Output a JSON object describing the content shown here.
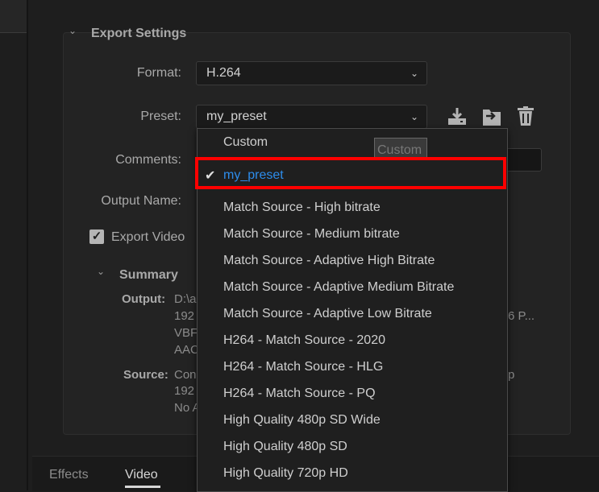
{
  "export_settings": {
    "title": "Export Settings",
    "format_label": "Format:",
    "format_value": "H.264",
    "preset_label": "Preset:",
    "preset_value": "my_preset",
    "comments_label": "Comments:",
    "output_name_label": "Output Name:",
    "export_video_label": "Export Video",
    "export_video_checked": true
  },
  "summary": {
    "title": "Summary",
    "output_label": "Output:",
    "output_lines": [
      "D:\\a",
      "192",
      "VBF",
      "AAC"
    ],
    "output_trailing": "6 P...",
    "source_label": "Source:",
    "source_lines": [
      "Con",
      "192",
      "No A"
    ],
    "source_trailing": "p"
  },
  "tabs": [
    {
      "label": "Effects",
      "active": false
    },
    {
      "label": "Video",
      "active": true
    }
  ],
  "preset_menu": {
    "items": [
      "Custom",
      "my_preset",
      "Match Source - High bitrate",
      "Match Source - Medium bitrate",
      "Match Source - Adaptive High Bitrate",
      "Match Source - Adaptive Medium Bitrate",
      "Match Source - Adaptive Low Bitrate",
      "H264 - Match Source - 2020",
      "H264 - Match Source - HLG",
      "H264 - Match Source - PQ",
      "High Quality 480p SD Wide",
      "High Quality 480p SD",
      "High Quality 720p HD"
    ],
    "selected_index": 1
  },
  "tooltip": "Custom",
  "icons": {
    "save_preset": "save-preset-icon",
    "import_preset": "import-preset-icon",
    "delete_preset": "delete-preset-icon"
  },
  "colors": {
    "selected_item": "#2d8ceb",
    "highlight_box": "#ff0000",
    "background": "#1e1e1e"
  }
}
